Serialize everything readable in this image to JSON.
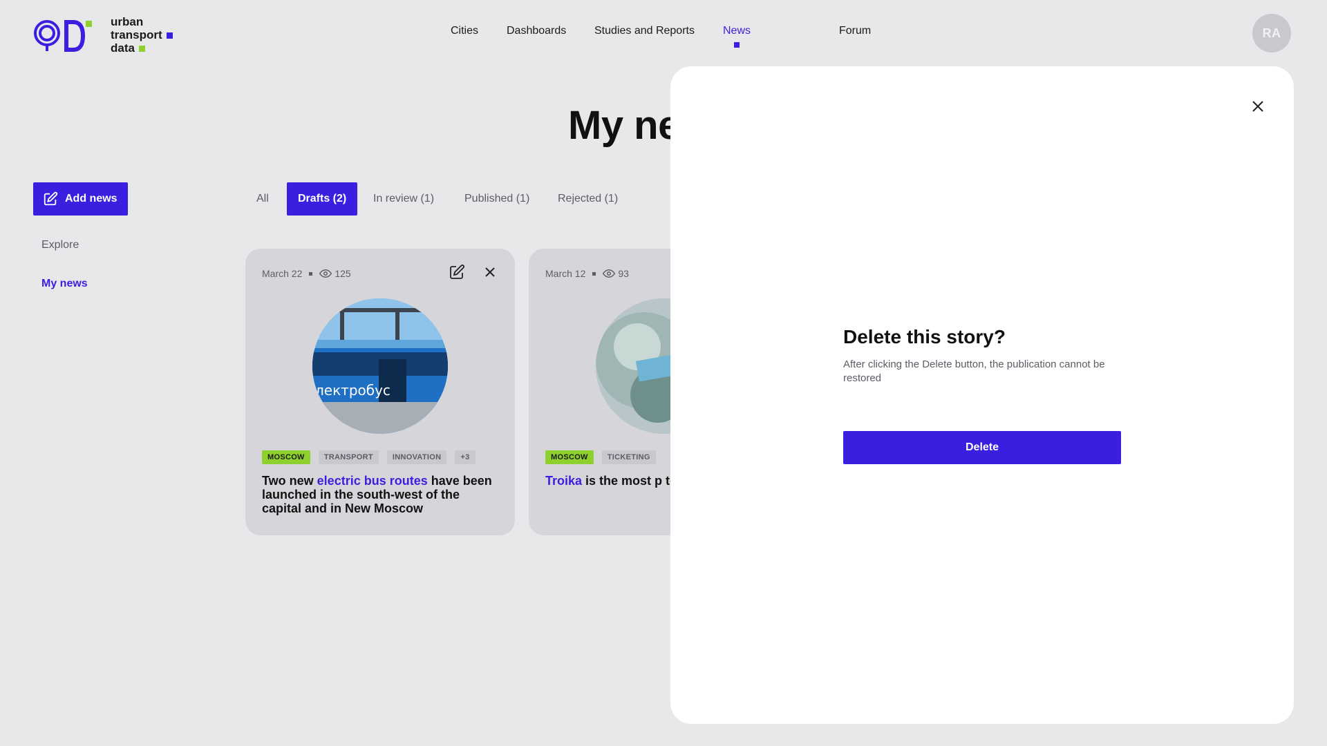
{
  "logo": {
    "lines": [
      "urban",
      "transport",
      "data"
    ]
  },
  "nav": {
    "items": [
      {
        "label": "Cities"
      },
      {
        "label": "Dashboards"
      },
      {
        "label": "Studies and Reports"
      },
      {
        "label": "News",
        "active": true
      },
      {
        "label": "Forum"
      }
    ]
  },
  "user": {
    "initials": "RA"
  },
  "page": {
    "title": "My news"
  },
  "sidebar": {
    "add_label": "Add news",
    "links": [
      {
        "label": "Explore"
      },
      {
        "label": "My news",
        "active": true
      }
    ]
  },
  "tabs": [
    {
      "label": "All"
    },
    {
      "label": "Drafts (2)",
      "active": true
    },
    {
      "label": "In review (1)"
    },
    {
      "label": "Published (1)"
    },
    {
      "label": "Rejected (1)"
    }
  ],
  "cards": [
    {
      "date": "March 22",
      "views": "125",
      "tags": [
        "MOSCOW",
        "TRANSPORT",
        "INNOVATION",
        "+3"
      ],
      "title_pre": "Two new ",
      "title_hl": "electric bus routes",
      "title_post": " have been launched in the south-west of the capital and in New Moscow",
      "image_text": "лектробус"
    },
    {
      "date": "March 12",
      "views": "93",
      "tags": [
        "MOSCOW",
        "TICKETING"
      ],
      "title_pre": "",
      "title_hl": "Troika",
      "title_post": " is the most p to pay for BKL trav"
    }
  ],
  "modal": {
    "title": "Delete this story?",
    "text": "After clicking the Delete button, the publication cannot be restored",
    "button": "Delete"
  },
  "colors": {
    "accent": "#3a1fe0",
    "green": "#8ed12e",
    "bg": "#e8e8ea"
  }
}
